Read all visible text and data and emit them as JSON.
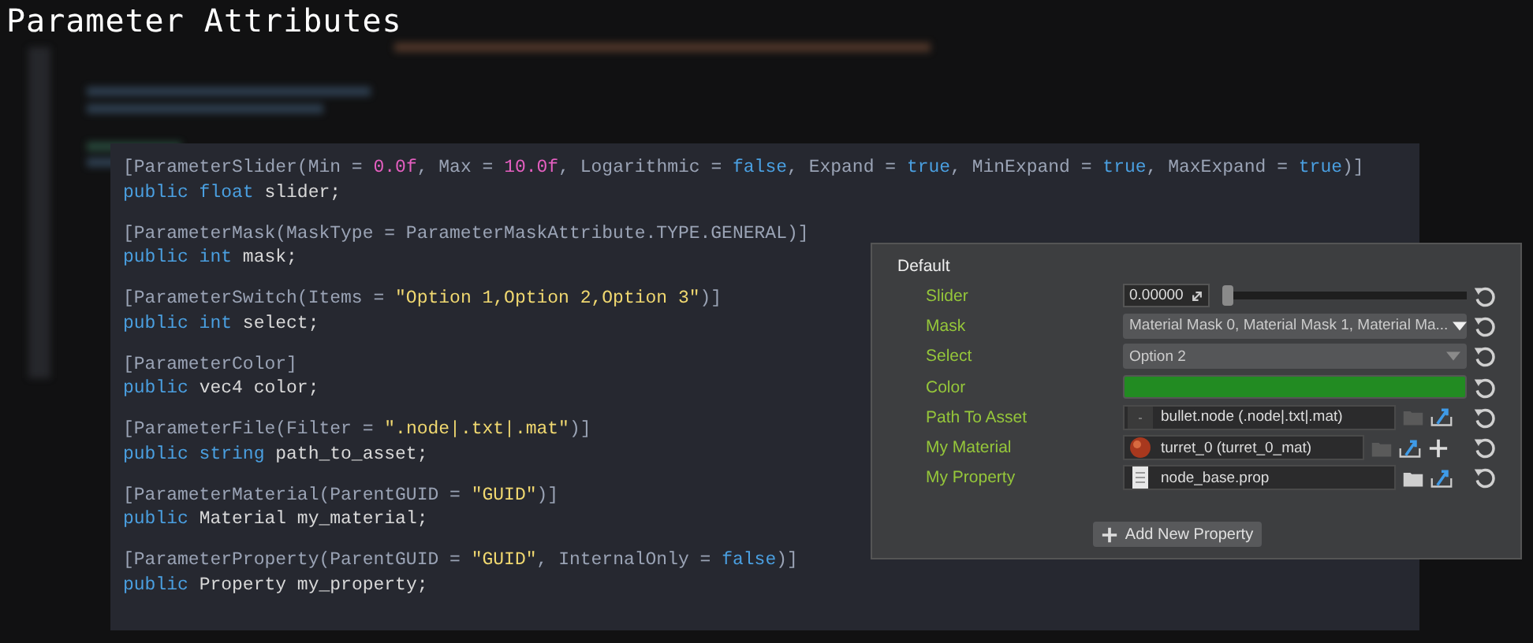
{
  "title": "Parameter Attributes",
  "code_blocks": [
    [
      [
        {
          "text": "[ParameterSlider(Min = ",
          "kind": "attr"
        },
        {
          "text": "0.0f",
          "kind": "number"
        },
        {
          "text": ", Max = ",
          "kind": "attr"
        },
        {
          "text": "10.0f",
          "kind": "number"
        },
        {
          "text": ", Logarithmic = ",
          "kind": "attr"
        },
        {
          "text": "false",
          "kind": "keyword"
        },
        {
          "text": ", Expand = ",
          "kind": "attr"
        },
        {
          "text": "true",
          "kind": "keyword"
        },
        {
          "text": ", MinExpand = ",
          "kind": "attr"
        },
        {
          "text": "true",
          "kind": "keyword"
        },
        {
          "text": ", MaxExpand = ",
          "kind": "attr"
        },
        {
          "text": "true",
          "kind": "keyword"
        },
        {
          "text": ")]",
          "kind": "attr"
        }
      ],
      [
        {
          "text": "public float",
          "kind": "keyword"
        },
        {
          "text": " slider;",
          "kind": "plain"
        }
      ]
    ],
    [
      [
        {
          "text": "[ParameterMask(MaskType = ParameterMaskAttribute.TYPE.GENERAL)]",
          "kind": "attr"
        }
      ],
      [
        {
          "text": "public int",
          "kind": "keyword"
        },
        {
          "text": " mask;",
          "kind": "plain"
        }
      ]
    ],
    [
      [
        {
          "text": "[ParameterSwitch(Items = ",
          "kind": "attr"
        },
        {
          "text": "\"Option 1,Option 2,Option 3\"",
          "kind": "string"
        },
        {
          "text": ")]",
          "kind": "attr"
        }
      ],
      [
        {
          "text": "public int",
          "kind": "keyword"
        },
        {
          "text": " select;",
          "kind": "plain"
        }
      ]
    ],
    [
      [
        {
          "text": "[ParameterColor]",
          "kind": "attr"
        }
      ],
      [
        {
          "text": "public",
          "kind": "keyword"
        },
        {
          "text": " vec4 color;",
          "kind": "plain"
        }
      ]
    ],
    [
      [
        {
          "text": "[ParameterFile(Filter = ",
          "kind": "attr"
        },
        {
          "text": "\".node|.txt|.mat\"",
          "kind": "string"
        },
        {
          "text": ")]",
          "kind": "attr"
        }
      ],
      [
        {
          "text": "public string",
          "kind": "keyword"
        },
        {
          "text": " path_to_asset;",
          "kind": "plain"
        }
      ]
    ],
    [
      [
        {
          "text": "[ParameterMaterial(ParentGUID = ",
          "kind": "attr"
        },
        {
          "text": "\"GUID\"",
          "kind": "string"
        },
        {
          "text": ")]",
          "kind": "attr"
        }
      ],
      [
        {
          "text": "public",
          "kind": "keyword"
        },
        {
          "text": " Material my_material;",
          "kind": "plain"
        }
      ]
    ],
    [
      [
        {
          "text": "[ParameterProperty(ParentGUID = ",
          "kind": "attr"
        },
        {
          "text": "\"GUID\"",
          "kind": "string"
        },
        {
          "text": ", InternalOnly = ",
          "kind": "attr"
        },
        {
          "text": "false",
          "kind": "keyword"
        },
        {
          "text": ")]",
          "kind": "attr"
        }
      ],
      [
        {
          "text": "public",
          "kind": "keyword"
        },
        {
          "text": " Property my_property;",
          "kind": "plain"
        }
      ]
    ]
  ],
  "panel": {
    "group": "Default",
    "rows": [
      {
        "kind": "slider",
        "label": "Slider",
        "value": "0.00000",
        "level": 0
      },
      {
        "kind": "mask",
        "label": "Mask",
        "value": "Material Mask 0, Material Mask 1, Material Ma..."
      },
      {
        "kind": "select",
        "label": "Select",
        "value": "Option 2"
      },
      {
        "kind": "color",
        "label": "Color",
        "color": "#228b22"
      },
      {
        "kind": "file",
        "label": "Path To Asset",
        "value": "bullet.node (.node|.txt|.mat)"
      },
      {
        "kind": "material",
        "label": "My Material",
        "value": "turret_0 (turret_0_mat)"
      },
      {
        "kind": "property",
        "label": "My Property",
        "value": "node_base.prop"
      }
    ],
    "add_button": "Add New Property"
  }
}
